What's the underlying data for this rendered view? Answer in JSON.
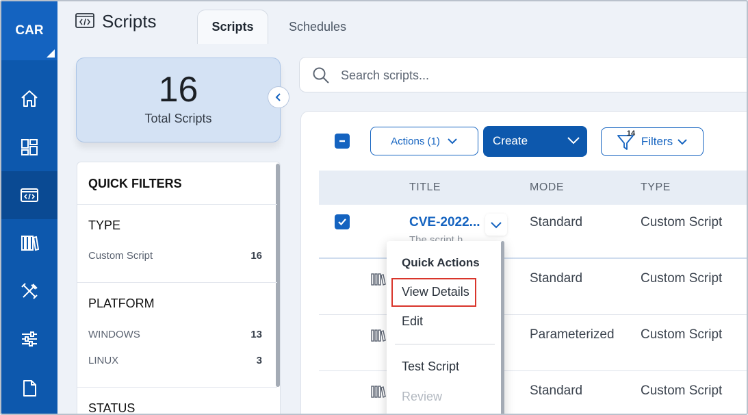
{
  "nav": {
    "brand": "CAR",
    "items": [
      {
        "icon": "home-icon"
      },
      {
        "icon": "dashboard-icon"
      },
      {
        "icon": "scripts-icon",
        "active": true
      },
      {
        "icon": "library-icon"
      },
      {
        "icon": "tools-icon"
      },
      {
        "icon": "settings-sliders-icon"
      },
      {
        "icon": "document-icon"
      }
    ]
  },
  "header": {
    "title": "Scripts",
    "tabs": [
      {
        "label": "Scripts",
        "active": true
      },
      {
        "label": "Schedules",
        "active": false
      }
    ]
  },
  "summary": {
    "count": "16",
    "label": "Total Scripts"
  },
  "quick_filters": {
    "title": "QUICK FILTERS",
    "sections": [
      {
        "name": "TYPE",
        "options": [
          {
            "label": "Custom Script",
            "count": "16"
          }
        ]
      },
      {
        "name": "PLATFORM",
        "options": [
          {
            "label": "WINDOWS",
            "count": "13"
          },
          {
            "label": "LINUX",
            "count": "3"
          }
        ]
      },
      {
        "name": "STATUS",
        "options": []
      }
    ]
  },
  "search": {
    "placeholder": "Search scripts..."
  },
  "toolbar": {
    "actions_label": "Actions (1)",
    "create_label": "Create",
    "filters_label": "Filters",
    "filters_badge": "14"
  },
  "table": {
    "columns": [
      "TITLE",
      "MODE",
      "TYPE"
    ],
    "rows": [
      {
        "title": "CVE-2022...",
        "description": "The script h",
        "mode": "Standard",
        "type": "Custom Script",
        "selected": true
      },
      {
        "title": "",
        "mode": "Standard",
        "type": "Custom Script",
        "selected": false
      },
      {
        "title": "",
        "mode": "Parameterized",
        "type": "Custom Script",
        "selected": false
      },
      {
        "title": "",
        "mode": "Standard",
        "type": "Custom Script",
        "selected": false
      }
    ]
  },
  "quick_actions_menu": {
    "header": "Quick Actions",
    "items": [
      {
        "label": "View Details",
        "highlighted": true
      },
      {
        "label": "Edit"
      },
      {
        "label": "Test Script"
      },
      {
        "label": "Review",
        "disabled": true
      }
    ]
  },
  "colors": {
    "primary": "#1463c0",
    "nav": "#0d58ad",
    "highlight_border": "#d9352b"
  }
}
